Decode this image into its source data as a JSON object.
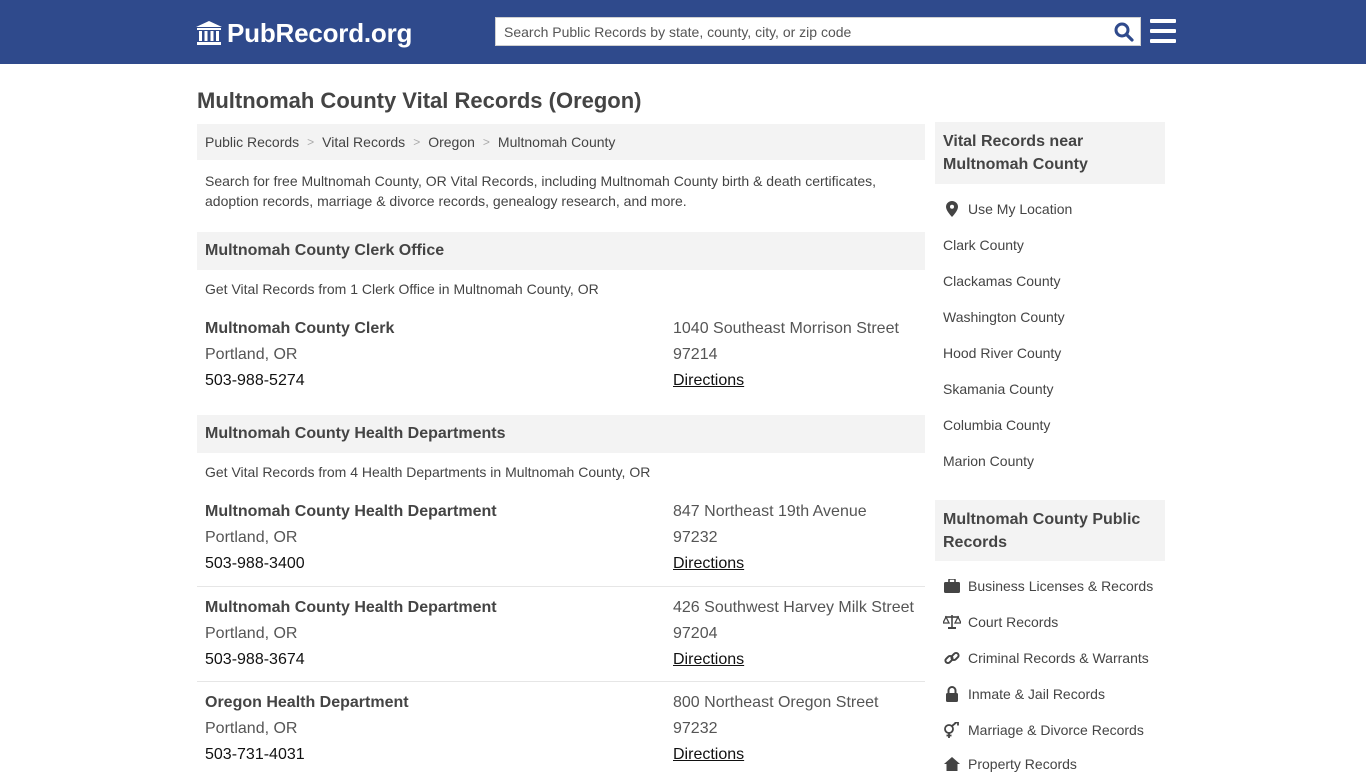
{
  "header": {
    "logo_text": "PubRecord.org",
    "search_placeholder": "Search Public Records by state, county, city, or zip code"
  },
  "page_title": "Multnomah County Vital Records (Oregon)",
  "breadcrumb": [
    "Public Records",
    "Vital Records",
    "Oregon",
    "Multnomah County"
  ],
  "intro": "Search for free Multnomah County, OR Vital Records, including Multnomah County birth & death certificates, adoption records, marriage & divorce records, genealogy research, and more.",
  "sections": [
    {
      "title": "Multnomah County Clerk Office",
      "desc": "Get Vital Records from 1 Clerk Office in Multnomah County, OR",
      "listings": [
        {
          "name": "Multnomah County Clerk",
          "city": "Portland, OR",
          "phone": "503-988-5274",
          "street": "1040 Southeast Morrison Street",
          "zip": "97214",
          "directions": "Directions"
        }
      ]
    },
    {
      "title": "Multnomah County Health Departments",
      "desc": "Get Vital Records from 4 Health Departments in Multnomah County, OR",
      "listings": [
        {
          "name": "Multnomah County Health Department",
          "city": "Portland, OR",
          "phone": "503-988-3400",
          "street": "847 Northeast 19th Avenue",
          "zip": "97232",
          "directions": "Directions"
        },
        {
          "name": "Multnomah County Health Department",
          "city": "Portland, OR",
          "phone": "503-988-3674",
          "street": "426 Southwest Harvey Milk Street",
          "zip": "97204",
          "directions": "Directions"
        },
        {
          "name": "Oregon Health Department",
          "city": "Portland, OR",
          "phone": "503-731-4031",
          "street": "800 Northeast Oregon Street",
          "zip": "97232",
          "directions": "Directions"
        }
      ]
    }
  ],
  "sidebar": {
    "nearby_title": "Vital Records near Multnomah County",
    "use_location": "Use My Location",
    "nearby": [
      "Clark County",
      "Clackamas County",
      "Washington County",
      "Hood River County",
      "Skamania County",
      "Columbia County",
      "Marion County"
    ],
    "public_title": "Multnomah County Public Records",
    "public": [
      {
        "label": "Business Licenses & Records",
        "icon": "briefcase-icon"
      },
      {
        "label": "Court Records",
        "icon": "scale-icon"
      },
      {
        "label": "Criminal Records & Warrants",
        "icon": "link-icon"
      },
      {
        "label": "Inmate & Jail Records",
        "icon": "lock-icon"
      },
      {
        "label": "Marriage & Divorce Records",
        "icon": "venus-mars-icon"
      },
      {
        "label": "Property Records",
        "icon": "home-icon"
      }
    ]
  },
  "colors": {
    "header_bg": "#2f4a8c",
    "panel_bg": "#f3f3f3",
    "search_icon": "#2f4a8c"
  }
}
